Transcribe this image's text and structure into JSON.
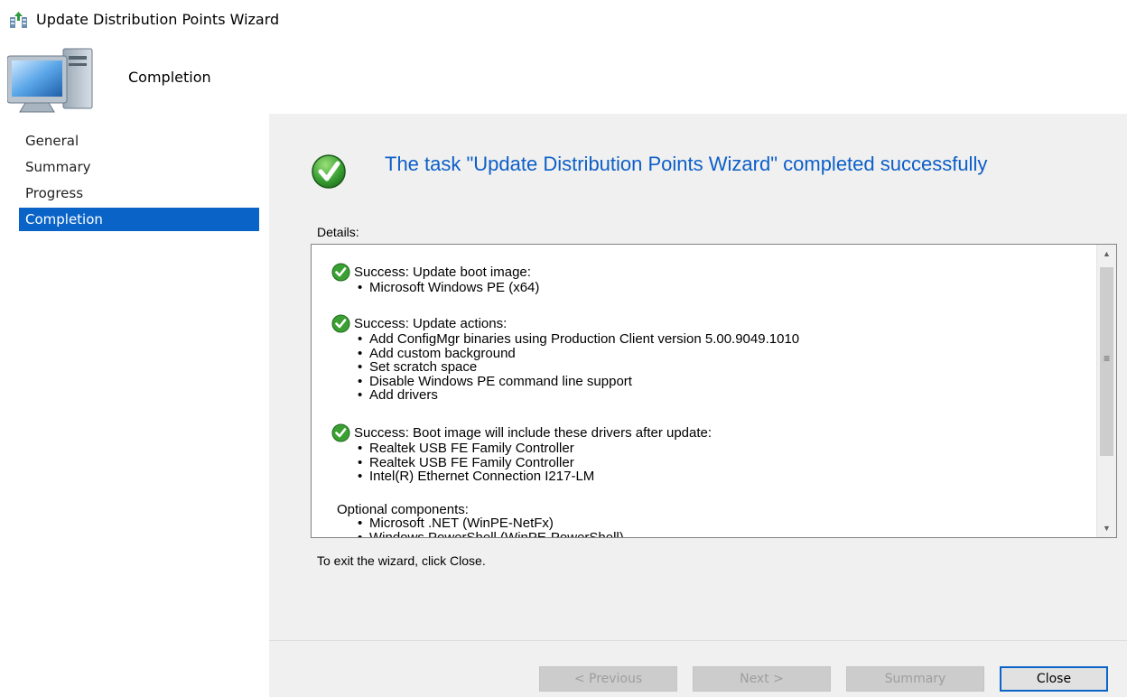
{
  "window": {
    "title": "Update Distribution Points Wizard"
  },
  "banner": {
    "heading": "Completion"
  },
  "nav": {
    "items": [
      {
        "label": "General",
        "active": false
      },
      {
        "label": "Summary",
        "active": false
      },
      {
        "label": "Progress",
        "active": false
      },
      {
        "label": "Completion",
        "active": true
      }
    ]
  },
  "main": {
    "result": "The task \"Update Distribution Points Wizard\" completed successfully",
    "details_label": "Details:",
    "details": {
      "groups": [
        {
          "heading": "Success: Update boot image:",
          "items": [
            "Microsoft Windows PE (x64)"
          ]
        },
        {
          "heading": "Success: Update actions:",
          "items": [
            "Add ConfigMgr binaries using Production Client version 5.00.9049.1010",
            "Add custom background",
            "Set scratch space",
            "Disable Windows PE command line support",
            "Add drivers"
          ]
        },
        {
          "heading": "Success: Boot image will include these drivers after update:",
          "items": [
            "Realtek USB FE Family Controller",
            "Realtek USB FE Family Controller",
            "Intel(R) Ethernet Connection I217-LM"
          ]
        }
      ],
      "optional_label": "Optional components:",
      "optional_items": [
        "Microsoft .NET (WinPE-NetFx)",
        "Windows PowerShell (WinPE-PowerShell)"
      ]
    },
    "exit_text": "To exit the wizard, click Close."
  },
  "buttons": {
    "previous": "< Previous",
    "next": "Next >",
    "summary": "Summary",
    "close": "Close"
  },
  "colors": {
    "accent": "#0a64c8",
    "heading_blue": "#0d5fc8",
    "panel_bg": "#f0f0f0",
    "success_green": "#3aa032"
  }
}
